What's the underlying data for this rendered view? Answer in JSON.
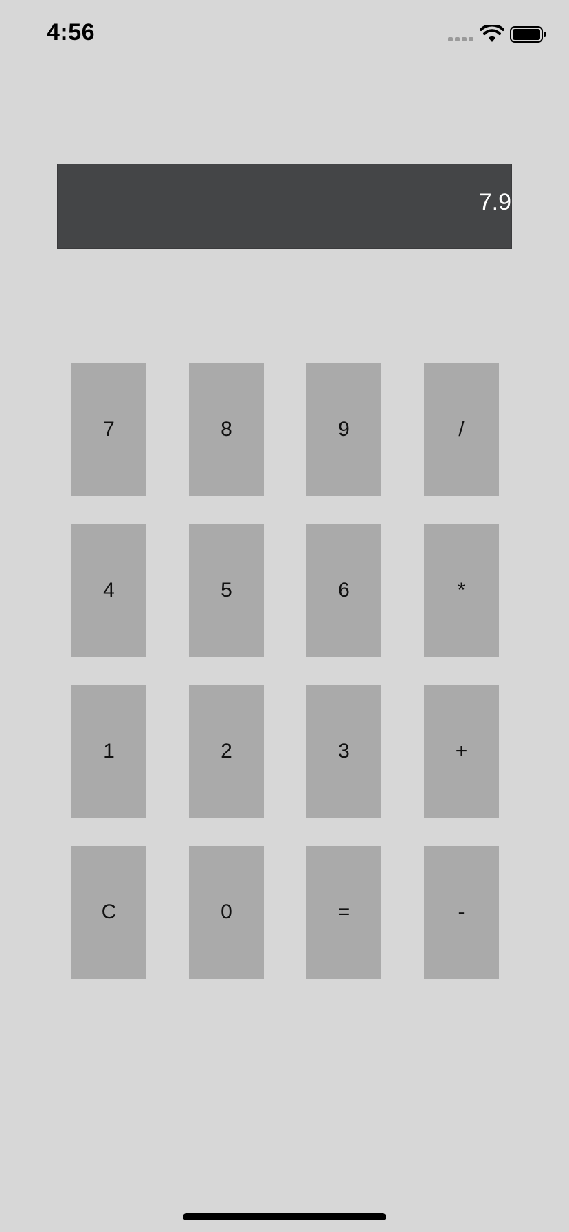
{
  "status_bar": {
    "time": "4:56",
    "icons": [
      "signal-icon",
      "wifi-icon",
      "battery-icon"
    ]
  },
  "display": {
    "value": "7.9"
  },
  "keypad": {
    "keys": [
      "7",
      "8",
      "9",
      "/",
      "4",
      "5",
      "6",
      "*",
      "1",
      "2",
      "3",
      "+",
      "C",
      "0",
      "=",
      "-"
    ]
  },
  "colors": {
    "background": "#d7d7d7",
    "display_background": "#444547",
    "display_text": "#ffffff",
    "key_background": "#aaaaaa",
    "key_text": "#111111"
  }
}
